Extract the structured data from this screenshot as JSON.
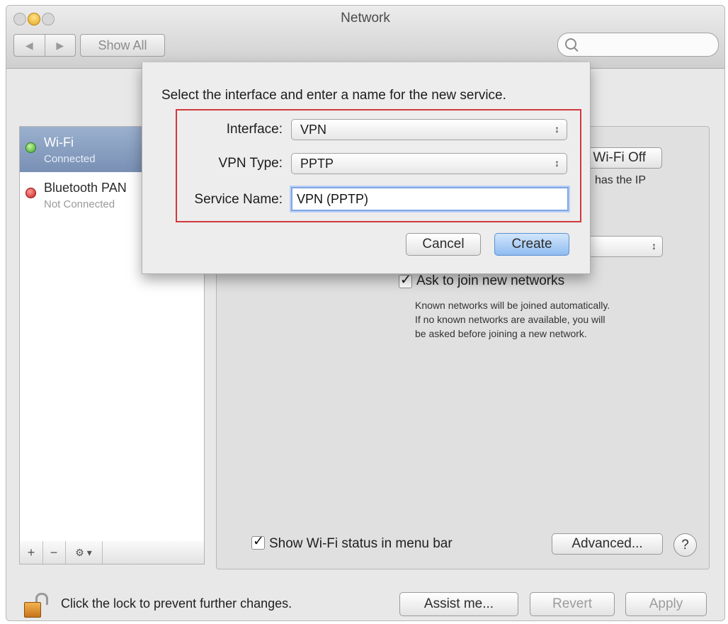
{
  "window": {
    "title": "Network"
  },
  "toolbar": {
    "back_label": "◀",
    "forward_label": "▶",
    "show_all_label": "Show All",
    "search_placeholder": ""
  },
  "sidebar": {
    "items": [
      {
        "name": "Wi-Fi",
        "status": "Connected",
        "status_color": "#3aa32c",
        "selected": true
      },
      {
        "name": "Bluetooth PAN",
        "status": "Not Connected",
        "status_color": "#c91d1d",
        "selected": false
      }
    ],
    "toolbar": {
      "add_label": "+",
      "remove_label": "−",
      "action_label": "⚙ ▾"
    }
  },
  "detail": {
    "wifi_off_label": "Wi-Fi Off",
    "status_text_fragment": "has the IP",
    "ask_join_label": "Ask to join new networks",
    "ask_join_checked": true,
    "ask_join_help": [
      "Known networks will be joined automatically.",
      "If no known networks are available, you will",
      "be asked before joining a new network."
    ],
    "show_status_label": "Show Wi-Fi status in menu bar",
    "show_status_checked": true,
    "advanced_label": "Advanced...",
    "help_label": "?"
  },
  "bottom": {
    "lock_text": "Click the lock to prevent further changes.",
    "assist_label": "Assist me...",
    "revert_label": "Revert",
    "apply_label": "Apply"
  },
  "sheet": {
    "prompt": "Select the interface and enter a name for the new service.",
    "interface_label": "Interface:",
    "interface_value": "VPN",
    "vpn_type_label": "VPN Type:",
    "vpn_type_value": "PPTP",
    "service_name_label": "Service Name:",
    "service_name_value": "VPN (PPTP)",
    "cancel_label": "Cancel",
    "create_label": "Create",
    "highlight_color": "#d0393d",
    "accent_color": "#8ebcf1"
  }
}
